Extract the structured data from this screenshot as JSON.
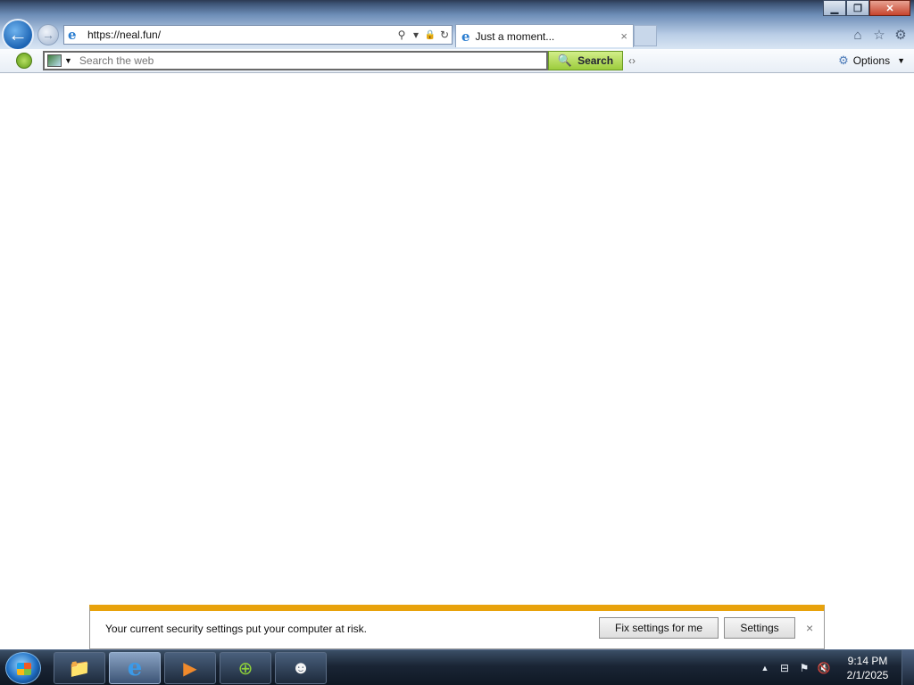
{
  "window": {
    "minimize": "▁",
    "restore": "❐",
    "close": "✕"
  },
  "nav": {
    "back_glyph": "←",
    "forward_glyph": "→"
  },
  "address": {
    "url": "https://neal.fun/",
    "site_icon": "e",
    "search_icon": "⚲",
    "dropdown_icon": "▾",
    "lock_icon": "🔒",
    "refresh_icon": "↻"
  },
  "tab": {
    "icon": "e",
    "title": "Just a moment...",
    "close": "×"
  },
  "toolbar_icons": {
    "home": "⌂",
    "favorites": "☆",
    "tools": "⚙"
  },
  "search_toolbar": {
    "placeholder": "Search the web",
    "caret": "▼",
    "button_label": "Search",
    "button_icon": "🔍",
    "grip": "‹›",
    "options_label": "Options",
    "options_icon": "⚙",
    "options_caret": "▼"
  },
  "notification": {
    "message": "Your current security settings put your computer at risk.",
    "fix_button": "Fix settings for me",
    "settings_button": "Settings",
    "close": "×"
  },
  "taskbar": {
    "apps": [
      {
        "name": "file-explorer",
        "glyph": "📁"
      },
      {
        "name": "internet-explorer",
        "glyph": "e"
      },
      {
        "name": "media-player",
        "glyph": "▶"
      },
      {
        "name": "green-app",
        "glyph": "⊕"
      },
      {
        "name": "mascot-app",
        "glyph": "☻"
      }
    ],
    "tray": {
      "show_hidden": "▲",
      "network": "⊟",
      "flag": "⚑",
      "volume": "🔇",
      "time": "9:14 PM",
      "date": "2/1/2025"
    }
  },
  "colors": {
    "notification_accent": "#e8a20b",
    "search_button": "#9ccc3c",
    "back_button": "#1c64b4"
  }
}
